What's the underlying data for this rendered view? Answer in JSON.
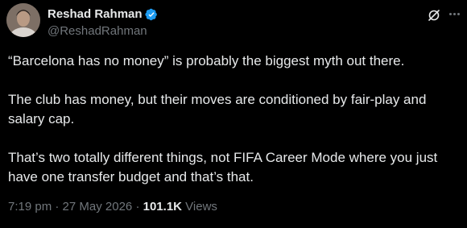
{
  "author": {
    "display_name": "Reshad Rahman",
    "handle": "@ReshadRahman",
    "verified_icon": "verified-badge-icon",
    "verified_color": "#1d9bf0"
  },
  "header_actions": {
    "grok_icon": "grok-icon",
    "more_icon": "more-options-icon"
  },
  "post": {
    "paragraphs": [
      "“Barcelona has no money” is probably the biggest myth out there.",
      "The club has money, but their moves are conditioned by fair-play and salary cap.",
      "That’s two totally different things, not FIFA Career Mode where you just have one transfer budget and that’s that."
    ]
  },
  "meta": {
    "time": "7:19 pm",
    "separator": " · ",
    "date": "27 May 2026",
    "views_count": "101.1K",
    "views_label": " Views"
  },
  "colors": {
    "background": "#000000",
    "text": "#e7e9ea",
    "secondary": "#71767b"
  }
}
